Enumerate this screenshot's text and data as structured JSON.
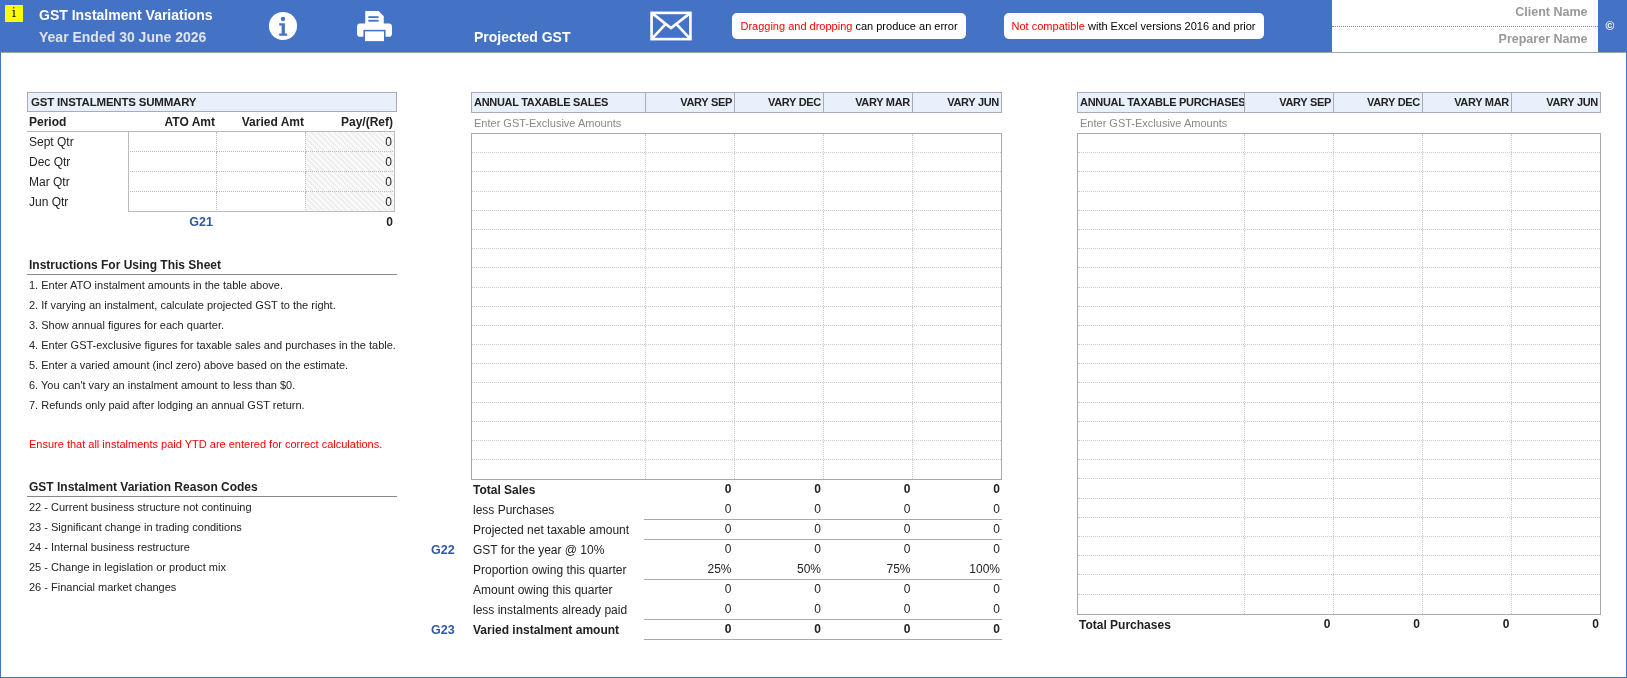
{
  "header": {
    "note_marker": "i",
    "title": "GST Instalment Variations",
    "subtitle": "Year Ended 30 June 2026",
    "projected_label": "Projected GST",
    "alerts": [
      {
        "highlight": "Dragging and dropping",
        "text": " can produce an error"
      },
      {
        "highlight": "Not compatible",
        "text": " with Excel versions 2016 and prior"
      }
    ],
    "client_name": "Client Name",
    "preparer_name": "Preparer Name",
    "copyright": "©"
  },
  "summary": {
    "title": "GST INSTALMENTS SUMMARY",
    "columns": [
      "Period",
      "ATO Amt",
      "Varied Amt",
      "Pay/(Ref)"
    ],
    "rows": [
      {
        "period": "Sept Qtr",
        "pay": "0"
      },
      {
        "period": "Dec Qtr",
        "pay": "0"
      },
      {
        "period": "Mar Qtr",
        "pay": "0"
      },
      {
        "period": "Jun Qtr",
        "pay": "0"
      }
    ],
    "total_code": "G21",
    "total": "0"
  },
  "instructions": {
    "title": "Instructions For Using This Sheet",
    "items": [
      "1. Enter ATO instalment amounts in the table above.",
      "2. If varying an instalment, calculate projected GST to the right.",
      "3. Show annual figures for each quarter.",
      "4. Enter GST-exclusive figures for taxable sales and purchases in the table.",
      "5. Enter a varied amount (incl zero) above based on the estimate.",
      "6. You can't vary an instalment amount to less than $0.",
      "7. Refunds only paid after lodging an annual GST return."
    ],
    "warning": "Ensure that all instalments paid YTD are entered for correct calculations."
  },
  "reason_codes": {
    "title": "GST Instalment Variation Reason Codes",
    "items": [
      "22 - Current business structure not continuing",
      "23 - Significant change in trading conditions",
      "24 - Internal business restructure",
      "25 - Change in legislation or product mix",
      "26 - Financial market changes"
    ]
  },
  "sales": {
    "columns": [
      "ANNUAL TAXABLE SALES",
      "VARY SEP",
      "VARY DEC",
      "VARY MAR",
      "VARY JUN"
    ],
    "hint": "Enter GST-Exclusive Amounts",
    "rows": [
      {
        "label": "Total Sales",
        "bold": true,
        "ruled": false,
        "values": [
          "0",
          "0",
          "0",
          "0"
        ]
      },
      {
        "label": "less Purchases",
        "bold": false,
        "ruled": true,
        "values": [
          "0",
          "0",
          "0",
          "0"
        ]
      },
      {
        "label": "Projected net taxable amount",
        "bold": false,
        "ruled": true,
        "values": [
          "0",
          "0",
          "0",
          "0"
        ]
      },
      {
        "code": "G22",
        "label": "GST for the year @ 10%",
        "bold": false,
        "ruled": false,
        "values": [
          "0",
          "0",
          "0",
          "0"
        ]
      },
      {
        "label": "Proportion owing this quarter",
        "bold": false,
        "ruled": true,
        "values": [
          "25%",
          "50%",
          "75%",
          "100%"
        ]
      },
      {
        "label": "Amount owing this quarter",
        "bold": false,
        "ruled": false,
        "values": [
          "0",
          "0",
          "0",
          "0"
        ]
      },
      {
        "label": "less instalments already paid",
        "bold": false,
        "ruled": true,
        "values": [
          "0",
          "0",
          "0",
          "0"
        ]
      },
      {
        "code": "G23",
        "label": "Varied instalment amount",
        "bold": true,
        "ruled": true,
        "values": [
          "0",
          "0",
          "0",
          "0"
        ]
      }
    ]
  },
  "purchases": {
    "columns": [
      "ANNUAL TAXABLE PURCHASES",
      "VARY SEP",
      "VARY DEC",
      "VARY MAR",
      "VARY JUN"
    ],
    "hint": "Enter GST-Exclusive Amounts",
    "total": {
      "label": "Total Purchases",
      "values": [
        "0",
        "0",
        "0",
        "0"
      ]
    }
  }
}
